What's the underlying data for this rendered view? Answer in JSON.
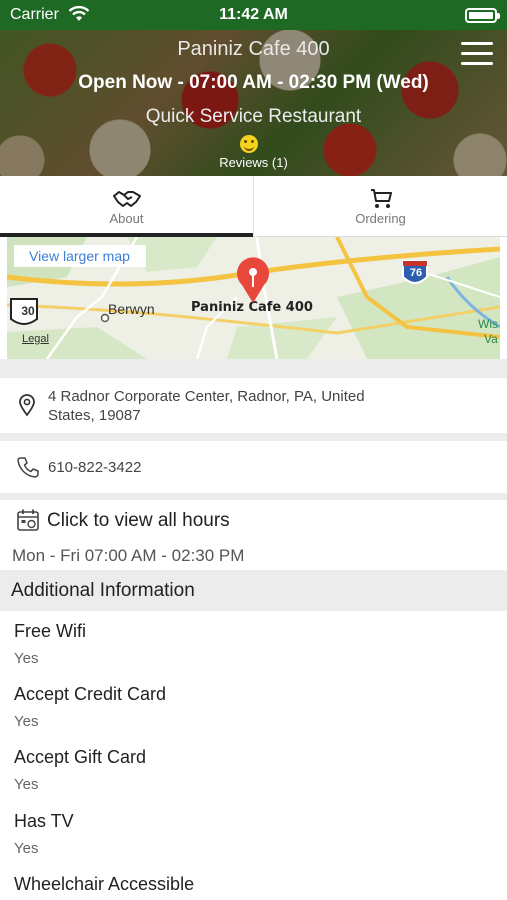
{
  "status_bar": {
    "carrier": "Carrier",
    "time": "11:42 AM"
  },
  "header": {
    "restaurant_name": "Paniniz Cafe 400",
    "hours_status": "Open Now - 07:00 AM - 02:30 PM (Wed)",
    "category": "Quick Service Restaurant",
    "reviews": "Reviews (1)"
  },
  "tabs": [
    {
      "label": "About",
      "icon": "handshake-icon",
      "active": true
    },
    {
      "label": "Ordering",
      "icon": "cart-icon",
      "active": false
    }
  ],
  "map": {
    "view_larger": "View larger map",
    "labels": {
      "berwyn": "Berwyn",
      "cafe": "Paniniz Cafe 400",
      "route_30": "30",
      "route_76": "76",
      "legal": "Legal",
      "edge_top": "Wis",
      "edge_bottom": "Va"
    },
    "pin_color": "#e8473b"
  },
  "address": "4 Radnor Corporate Center, Radnor, PA, United States, 19087",
  "phone": "610-822-3422",
  "hours": {
    "link": "Click to view all hours",
    "schedule": "Mon - Fri 07:00 AM - 02:30 PM"
  },
  "additional_info": {
    "title": "Additional Information",
    "items": [
      {
        "name": "Free Wifi",
        "value": "Yes"
      },
      {
        "name": "Accept Credit Card",
        "value": "Yes"
      },
      {
        "name": "Accept Gift Card",
        "value": "Yes"
      },
      {
        "name": "Has TV",
        "value": "Yes"
      },
      {
        "name": "Wheelchair Accessible",
        "value": ""
      }
    ]
  },
  "colors": {
    "status_bar": "#1e6a24",
    "map_link": "#3d7fd6"
  }
}
